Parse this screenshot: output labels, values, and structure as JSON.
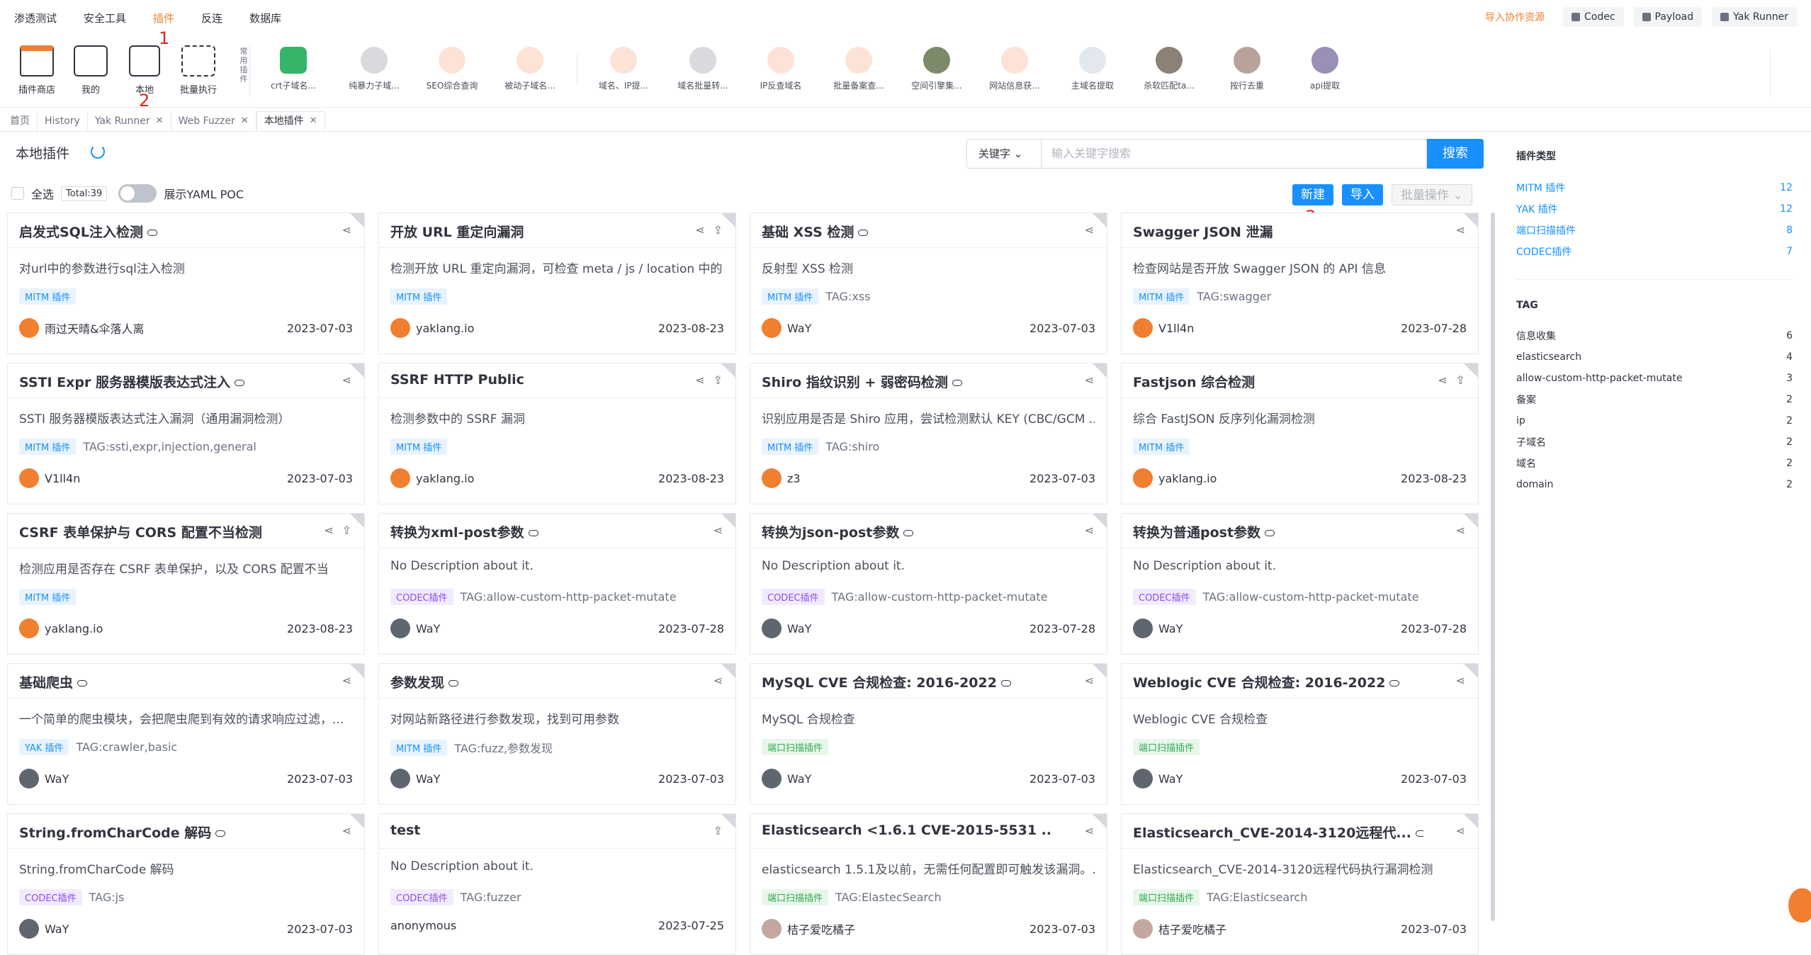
{
  "topnav": {
    "items": [
      "渗透测试",
      "安全工具",
      "插件",
      "反连",
      "数据库"
    ],
    "active": 2
  },
  "topright": {
    "import_label": "导入协作资源",
    "buttons": [
      "Codec",
      "Payload",
      "Yak Runner"
    ]
  },
  "annotations": [
    "1",
    "2",
    "3"
  ],
  "toolbar": {
    "tools": [
      "插件商店",
      "我的",
      "本地",
      "批量执行"
    ],
    "common_label": "常用插件",
    "quick_plugins": [
      "crt子域名...",
      "纯暴力子域...",
      "SEO综合查询",
      "被动子域名...",
      "域名、IP提...",
      "域名批量转...",
      "IP反查域名",
      "批量备案查...",
      "空间引擎集...",
      "网站信息获...",
      "主域名提取",
      "杀软匹配ta...",
      "按行去重",
      "api提取"
    ]
  },
  "tabs": [
    "首页",
    "History",
    "Yak Runner",
    "Web Fuzzer",
    "本地插件"
  ],
  "page": {
    "title": "本地插件",
    "search_mode": "关键字",
    "search_placeholder": "输入关键字搜索",
    "search_button": "搜索",
    "select_all": "全选",
    "total": "Total:39",
    "yaml_toggle": "展示YAML POC",
    "new_button": "新建",
    "import_button": "导入",
    "batch_button": "批量操作"
  },
  "cards": [
    {
      "title": "启发式SQL注入检测",
      "desc": "对url中的参数进行sql注入检测",
      "type": "MITM 插件",
      "tag": "",
      "author": "雨过天晴&伞落人离",
      "date": "2023-07-03"
    },
    {
      "title": "开放 URL 重定向漏洞",
      "desc": "检测开放 URL 重定向漏洞，可检查 meta / js / location 中的...",
      "type": "MITM 插件",
      "tag": "",
      "author": "yaklang.io",
      "date": "2023-08-23"
    },
    {
      "title": "基础 XSS 检测",
      "desc": "反射型 XSS 检测",
      "type": "MITM 插件",
      "tag": "TAG:xss",
      "author": "WaY",
      "date": "2023-07-03"
    },
    {
      "title": "Swagger JSON 泄漏",
      "desc": "检查网站是否开放 Swagger JSON 的 API 信息",
      "type": "MITM 插件",
      "tag": "TAG:swagger",
      "author": "V1ll4n",
      "date": "2023-07-28"
    },
    {
      "title": "SSTI Expr 服务器模版表达式注入",
      "desc": "SSTI 服务器模版表达式注入漏洞（通用漏洞检测）",
      "type": "MITM 插件",
      "tag": "TAG:ssti,expr,injection,general",
      "author": "V1ll4n",
      "date": "2023-07-03"
    },
    {
      "title": "SSRF HTTP Public",
      "desc": "检测参数中的 SSRF 漏洞",
      "type": "MITM 插件",
      "tag": "",
      "author": "yaklang.io",
      "date": "2023-08-23"
    },
    {
      "title": "Shiro 指纹识别 + 弱密码检测",
      "desc": "识别应用是否是 Shiro 应用，尝试检测默认 KEY (CBC/GCM ...",
      "type": "MITM 插件",
      "tag": "TAG:shiro",
      "author": "z3",
      "date": "2023-07-03"
    },
    {
      "title": "Fastjson 综合检测",
      "desc": "综合 FastJSON 反序列化漏洞检测",
      "type": "MITM 插件",
      "tag": "",
      "author": "yaklang.io",
      "date": "2023-08-23"
    },
    {
      "title": "CSRF 表单保护与 CORS 配置不当检测",
      "desc": "检测应用是否存在 CSRF 表单保护，以及 CORS 配置不当",
      "type": "MITM 插件",
      "tag": "",
      "author": "yaklang.io",
      "date": "2023-08-23"
    },
    {
      "title": "转换为xml-post参数",
      "desc": "No Description about it.",
      "type": "CODEC插件",
      "tag": "TAG:allow-custom-http-packet-mutate",
      "author": "WaY",
      "date": "2023-07-28"
    },
    {
      "title": "转换为json-post参数",
      "desc": "No Description about it.",
      "type": "CODEC插件",
      "tag": "TAG:allow-custom-http-packet-mutate",
      "author": "WaY",
      "date": "2023-07-28"
    },
    {
      "title": "转换为普通post参数",
      "desc": "No Description about it.",
      "type": "CODEC插件",
      "tag": "TAG:allow-custom-http-packet-mutate",
      "author": "WaY",
      "date": "2023-07-28"
    },
    {
      "title": "基础爬虫",
      "desc": "一个简单的爬虫模块，会把爬虫爬到有效的请求响应过滤，...",
      "type": "YAK 插件",
      "tag": "TAG:crawler,basic",
      "author": "WaY",
      "date": "2023-07-03"
    },
    {
      "title": "参数发现",
      "desc": "对网站新路径进行参数发现，找到可用参数",
      "type": "MITM 插件",
      "tag": "TAG:fuzz,参数发现",
      "author": "WaY",
      "date": "2023-07-03"
    },
    {
      "title": "MySQL CVE 合规检查: 2016-2022",
      "desc": "MySQL 合规检查",
      "type": "端口扫描插件",
      "tag": "",
      "author": "WaY",
      "date": "2023-07-03"
    },
    {
      "title": "Weblogic CVE 合规检查: 2016-2022",
      "desc": "Weblogic CVE 合规检查",
      "type": "端口扫描插件",
      "tag": "",
      "author": "WaY",
      "date": "2023-07-03"
    },
    {
      "title": "String.fromCharCode 解码",
      "desc": "String.fromCharCode 解码",
      "type": "CODEC插件",
      "tag": "TAG:js",
      "author": "WaY",
      "date": "2023-07-03"
    },
    {
      "title": "test",
      "desc": "No Description about it.",
      "type": "CODEC插件",
      "tag": "TAG:fuzzer",
      "author": "anonymous",
      "date": "2023-07-25"
    },
    {
      "title": "Elasticsearch <1.6.1 CVE-2015-5531 ...",
      "desc": "elasticsearch 1.5.1及以前，无需任何配置即可触发该漏洞。...",
      "type": "端口扫描插件",
      "tag": "TAG:ElastecSearch",
      "author": "桔子爱吃橘子",
      "date": "2023-07-03"
    },
    {
      "title": "Elasticsearch_CVE-2014-3120远程代...",
      "desc": "Elasticsearch_CVE-2014-3120远程代码执行漏洞检测",
      "type": "端口扫描插件",
      "tag": "TAG:Elasticsearch",
      "author": "桔子爱吃橘子",
      "date": "2023-07-03"
    }
  ],
  "sidebar": {
    "types_title": "插件类型",
    "types": [
      {
        "name": "MITM 插件",
        "count": "12"
      },
      {
        "name": "YAK 插件",
        "count": "12"
      },
      {
        "name": "端口扫描插件",
        "count": "8"
      },
      {
        "name": "CODEC插件",
        "count": "7"
      }
    ],
    "tag_title": "TAG",
    "tags": [
      {
        "name": "信息收集",
        "count": "6"
      },
      {
        "name": "elasticsearch",
        "count": "4"
      },
      {
        "name": "allow-custom-http-packet-mutate",
        "count": "3"
      },
      {
        "name": "备案",
        "count": "2"
      },
      {
        "name": "ip",
        "count": "2"
      },
      {
        "name": "子域名",
        "count": "2"
      },
      {
        "name": "域名",
        "count": "2"
      },
      {
        "name": "domain",
        "count": "2"
      }
    ]
  },
  "colors": {
    "accent": "#1890ff",
    "brand": "#f17f30",
    "annotation": "#e0231c"
  }
}
